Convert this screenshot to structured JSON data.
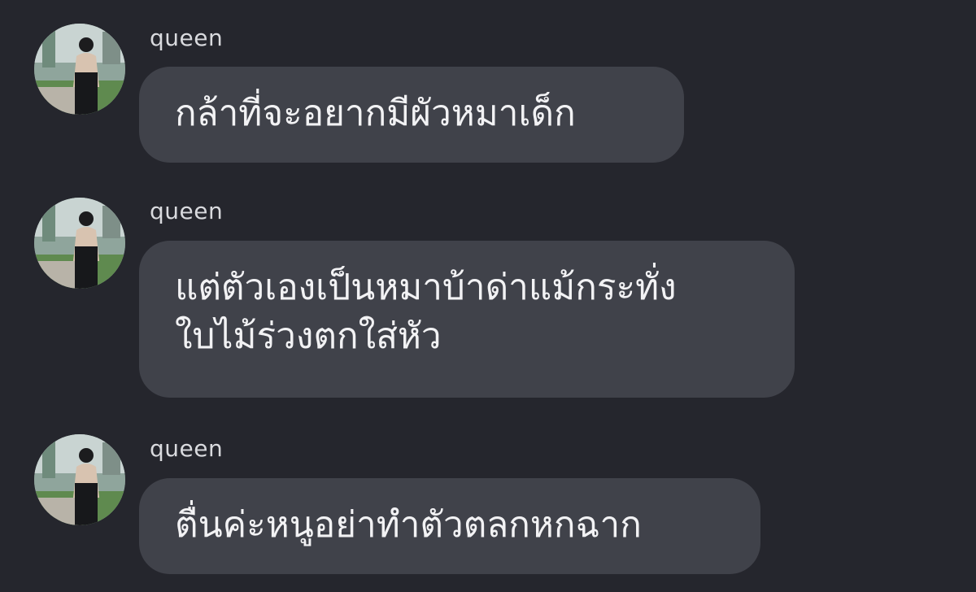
{
  "messages": [
    {
      "sender": "queen",
      "avatar_icon": "profile-photo-avatar",
      "text": "กล้าที่จะอยากมีผัวหมาเด็ก"
    },
    {
      "sender": "queen",
      "avatar_icon": "profile-photo-avatar",
      "text": "แต่ตัวเองเป็นหมาบ้าด่าแม้กระทั่ง\nใบไม้ร่วงตกใส่หัว"
    },
    {
      "sender": "queen",
      "avatar_icon": "profile-photo-avatar",
      "text": "ตื่นค่ะหนูอย่าทำตัวตลกหกฉาก"
    }
  ],
  "colors": {
    "background": "#25262d",
    "bubble": "#40424a",
    "text": "#f2f2f4",
    "sender": "#d9dade"
  }
}
